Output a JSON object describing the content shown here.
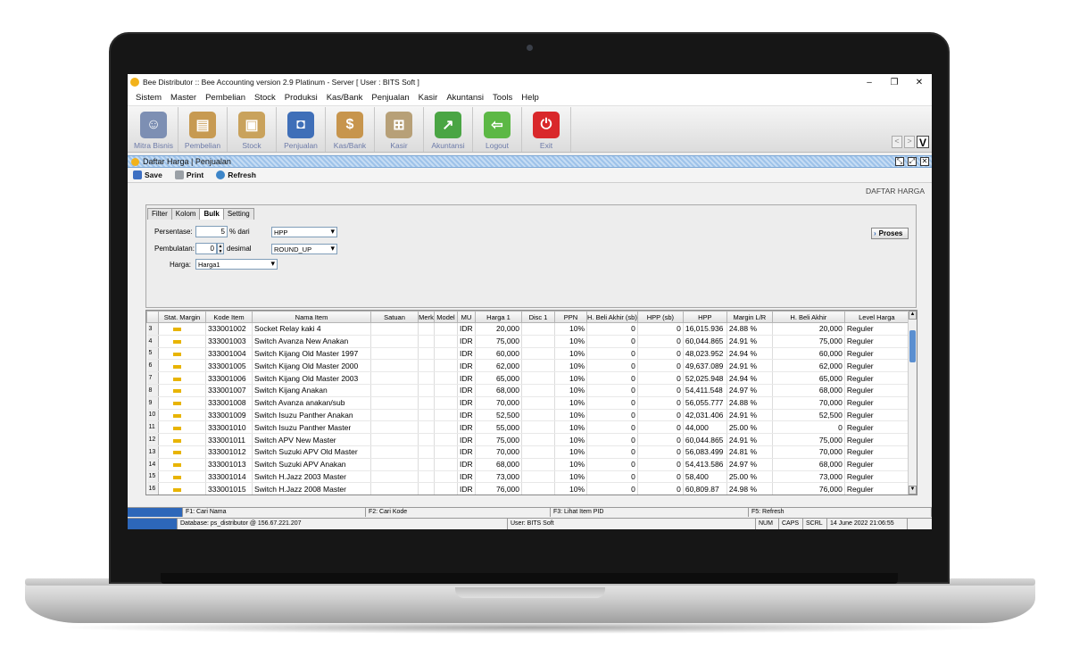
{
  "window": {
    "title": "Bee Distributor :: Bee Accounting version 2.9 Platinum - Server  [ User : BITS Soft ]",
    "minimize": "–",
    "maximize": "❐",
    "close": "✕"
  },
  "menu": [
    "Sistem",
    "Master",
    "Pembelian",
    "Stock",
    "Produksi",
    "Kas/Bank",
    "Penjualan",
    "Kasir",
    "Akuntansi",
    "Tools",
    "Help"
  ],
  "toolbar": [
    {
      "label": "Mitra Bisnis",
      "icon": "people-icon",
      "color": "#7d8fb3"
    },
    {
      "label": "Pembelian",
      "icon": "documents-icon",
      "color": "#c79a52"
    },
    {
      "label": "Stock",
      "icon": "box-icon",
      "color": "#c9a25c"
    },
    {
      "label": "Penjualan",
      "icon": "shopping-bag-icon",
      "color": "#3f6fb8"
    },
    {
      "label": "Kas/Bank",
      "icon": "money-bag-icon",
      "color": "#c7954d"
    },
    {
      "label": "Kasir",
      "icon": "cart-icon",
      "color": "#b7a078"
    },
    {
      "label": "Akuntansi",
      "icon": "growth-chart-icon",
      "color": "#4aa544"
    },
    {
      "label": "Logout",
      "icon": "logout-icon",
      "color": "#5cb845"
    },
    {
      "label": "Exit",
      "icon": "power-icon",
      "color": "#d9282b"
    }
  ],
  "nav": {
    "prev": "<",
    "next": ">",
    "logo": "V"
  },
  "form": {
    "title": "Daftar Harga | Penjualan",
    "page_label": "DAFTAR HARGA"
  },
  "actions": {
    "save": "Save",
    "print": "Print",
    "refresh": "Refresh"
  },
  "tabs": [
    "Filter",
    "Kolom",
    "Bulk",
    "Setting"
  ],
  "bulk": {
    "persentase_label": "Persentase:",
    "persentase_value": "5",
    "persentase_suffix": "% dari",
    "basis": "HPP",
    "pembulatan_label": "Pembulatan:",
    "pembulatan_value": "0",
    "pembulatan_suffix": "desimal",
    "rounding": "ROUND_UP",
    "harga_label": "Harga:",
    "harga_value": "Harga1",
    "proses": "Proses"
  },
  "columns": [
    "",
    "Stat. Margin",
    "Kode Item",
    "Nama Item",
    "Satuan",
    "Merk",
    "Model",
    "MU",
    "Harga 1",
    "Disc 1",
    "PPN",
    "H. Beli Akhir (sb)",
    "HPP (sb)",
    "HPP",
    "Margin L/R",
    "H. Beli Akhir",
    "Level Harga"
  ],
  "rows": [
    [
      "3",
      "333001002",
      "Socket Relay kaki 4",
      "IDR",
      "20,000",
      "10%",
      "0",
      "0",
      "16,015.936",
      "24.88 %",
      "20,000",
      "Reguler"
    ],
    [
      "4",
      "333001003",
      "Switch Avanza New Anakan",
      "IDR",
      "75,000",
      "10%",
      "0",
      "0",
      "60,044.865",
      "24.91 %",
      "75,000",
      "Reguler"
    ],
    [
      "5",
      "333001004",
      "Switch Kijang Old Master 1997",
      "IDR",
      "60,000",
      "10%",
      "0",
      "0",
      "48,023.952",
      "24.94 %",
      "60,000",
      "Reguler"
    ],
    [
      "6",
      "333001005",
      "Switch Kijang Old Master 2000",
      "IDR",
      "62,000",
      "10%",
      "0",
      "0",
      "49,637.089",
      "24.91 %",
      "62,000",
      "Reguler"
    ],
    [
      "7",
      "333001006",
      "Switch Kijang Old Master 2003",
      "IDR",
      "65,000",
      "10%",
      "0",
      "0",
      "52,025.948",
      "24.94 %",
      "65,000",
      "Reguler"
    ],
    [
      "8",
      "333001007",
      "Switch Kijang Anakan",
      "IDR",
      "68,000",
      "10%",
      "0",
      "0",
      "54,411.548",
      "24.97 %",
      "68,000",
      "Reguler"
    ],
    [
      "9",
      "333001008",
      "Switch Avanza anakan/sub",
      "IDR",
      "70,000",
      "10%",
      "0",
      "0",
      "56,055.777",
      "24.88 %",
      "70,000",
      "Reguler"
    ],
    [
      "10",
      "333001009",
      "Switch Isuzu Panther Anakan",
      "IDR",
      "52,500",
      "10%",
      "0",
      "0",
      "42,031.406",
      "24.91 %",
      "52,500",
      "Reguler"
    ],
    [
      "11",
      "333001010",
      "Switch Isuzu Panther Master",
      "IDR",
      "55,000",
      "10%",
      "0",
      "0",
      "44,000",
      "25.00 %",
      "0",
      "Reguler"
    ],
    [
      "12",
      "333001011",
      "Switch APV New Master",
      "IDR",
      "75,000",
      "10%",
      "0",
      "0",
      "60,044.865",
      "24.91 %",
      "75,000",
      "Reguler"
    ],
    [
      "13",
      "333001012",
      "Switch Suzuki APV Old Master",
      "IDR",
      "70,000",
      "10%",
      "0",
      "0",
      "56,083.499",
      "24.81 %",
      "70,000",
      "Reguler"
    ],
    [
      "14",
      "333001013",
      "Switch Suzuki APV Anakan",
      "IDR",
      "68,000",
      "10%",
      "0",
      "0",
      "54,413.586",
      "24.97 %",
      "68,000",
      "Reguler"
    ],
    [
      "15",
      "333001014",
      "Switch H.Jazz 2003 Master",
      "IDR",
      "73,000",
      "10%",
      "0",
      "0",
      "58,400",
      "25.00 %",
      "73,000",
      "Reguler"
    ],
    [
      "16",
      "333001015",
      "Switch H.Jazz 2008 Master",
      "IDR",
      "76,000",
      "10%",
      "0",
      "0",
      "60,809.87",
      "24.98 %",
      "76,000",
      "Reguler"
    ]
  ],
  "status1": [
    "F1: Cari Nama",
    "F2: Cari Kode",
    "F3: Lihat Item PID",
    "F5: Refresh"
  ],
  "status2": {
    "db": "Database: ps_distributor @ 156.67.221.207",
    "user": "User: BITS Soft",
    "num": "NUM",
    "caps": "CAPS",
    "scrl": "SCRL",
    "datetime": "14 June 2022  21:06:55"
  }
}
